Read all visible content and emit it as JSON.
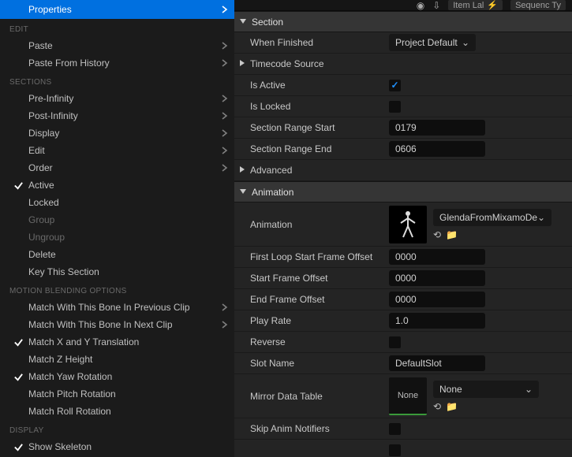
{
  "top_bar": {
    "item_label": "Item Lal",
    "sequence_label": "Sequenc Ty"
  },
  "context_menu": {
    "properties": "Properties",
    "groups": [
      {
        "header": "EDIT",
        "items": [
          {
            "label": "Paste",
            "arrow": true
          },
          {
            "label": "Paste From History",
            "arrow": true
          }
        ]
      },
      {
        "header": "SECTIONS",
        "items": [
          {
            "label": "Pre-Infinity",
            "arrow": true
          },
          {
            "label": "Post-Infinity",
            "arrow": true
          },
          {
            "label": "Display",
            "arrow": true
          },
          {
            "label": "Edit",
            "arrow": true
          },
          {
            "label": "Order",
            "arrow": true
          },
          {
            "label": "Active",
            "checked": true
          },
          {
            "label": "Locked"
          },
          {
            "label": "Group",
            "disabled": true
          },
          {
            "label": "Ungroup",
            "disabled": true
          },
          {
            "label": "Delete"
          },
          {
            "label": "Key This Section"
          }
        ]
      },
      {
        "header": "MOTION BLENDING OPTIONS",
        "items": [
          {
            "label": "Match With This Bone In Previous Clip",
            "arrow": true
          },
          {
            "label": "Match With This Bone In Next Clip",
            "arrow": true
          },
          {
            "label": "Match X and Y Translation",
            "checked": true
          },
          {
            "label": "Match Z Height"
          },
          {
            "label": "Match Yaw Rotation",
            "checked": true
          },
          {
            "label": "Match Pitch Rotation"
          },
          {
            "label": "Match Roll Rotation"
          }
        ]
      },
      {
        "header": "DISPLAY",
        "items": [
          {
            "label": "Show Skeleton",
            "checked": true
          }
        ]
      }
    ]
  },
  "sections": {
    "section_header": "Section",
    "when_finished": {
      "label": "When Finished",
      "value": "Project Default"
    },
    "timecode_source": {
      "label": "Timecode Source"
    },
    "is_active": {
      "label": "Is Active",
      "value": true
    },
    "is_locked": {
      "label": "Is Locked",
      "value": false
    },
    "range_start": {
      "label": "Section Range Start",
      "value": "0179"
    },
    "range_end": {
      "label": "Section Range End",
      "value": "0606"
    },
    "advanced": {
      "label": "Advanced"
    },
    "animation_header": "Animation",
    "animation": {
      "label": "Animation",
      "value": "GlendaFromMixamoDe"
    },
    "first_loop": {
      "label": "First Loop Start Frame Offset",
      "value": "0000"
    },
    "start_offset": {
      "label": "Start Frame Offset",
      "value": "0000"
    },
    "end_offset": {
      "label": "End Frame Offset",
      "value": "0000"
    },
    "play_rate": {
      "label": "Play Rate",
      "value": "1.0"
    },
    "reverse": {
      "label": "Reverse",
      "value": false
    },
    "slot_name": {
      "label": "Slot Name",
      "value": "DefaultSlot"
    },
    "mirror_table": {
      "label": "Mirror Data Table",
      "value": "None",
      "thumb": "None"
    },
    "skip_notifiers": {
      "label": "Skip Anim Notifiers",
      "value": false
    }
  }
}
